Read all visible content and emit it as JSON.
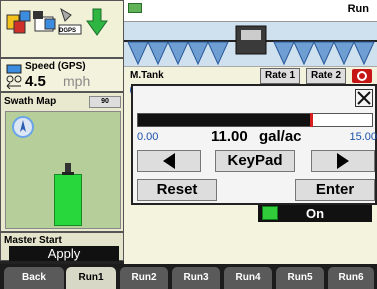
{
  "toolbar": {
    "gps_label": "DGPS"
  },
  "speed": {
    "label": "Speed (GPS)",
    "value": "4.5",
    "unit": "mph"
  },
  "swath_map": {
    "title": "Swath Map",
    "zoom_label": "90"
  },
  "master": {
    "label": "Master Start",
    "button": "Apply"
  },
  "top_bar": {
    "status": "Run"
  },
  "tank": {
    "label": "M.Tank",
    "rate_tabs": [
      "Rate 1",
      "Rate 2"
    ]
  },
  "section_status": "On",
  "dialog": {
    "min": "0.00",
    "max": "15.00",
    "value": "11.00",
    "unit": "gal/ac",
    "level_fraction": 0.733,
    "keypad_label": "KeyPad",
    "reset_label": "Reset",
    "enter_label": "Enter"
  },
  "tabs": [
    {
      "label": "Back",
      "active": false
    },
    {
      "label": "Run1",
      "active": true
    },
    {
      "label": "Run2",
      "active": false
    },
    {
      "label": "Run3",
      "active": false
    },
    {
      "label": "Run4",
      "active": false
    },
    {
      "label": "Run5",
      "active": false
    },
    {
      "label": "Run6",
      "active": false
    }
  ],
  "colors": {
    "coverage": "#28d73c",
    "slider_marker": "#d81f1f",
    "range_text": "#1b52a8"
  }
}
